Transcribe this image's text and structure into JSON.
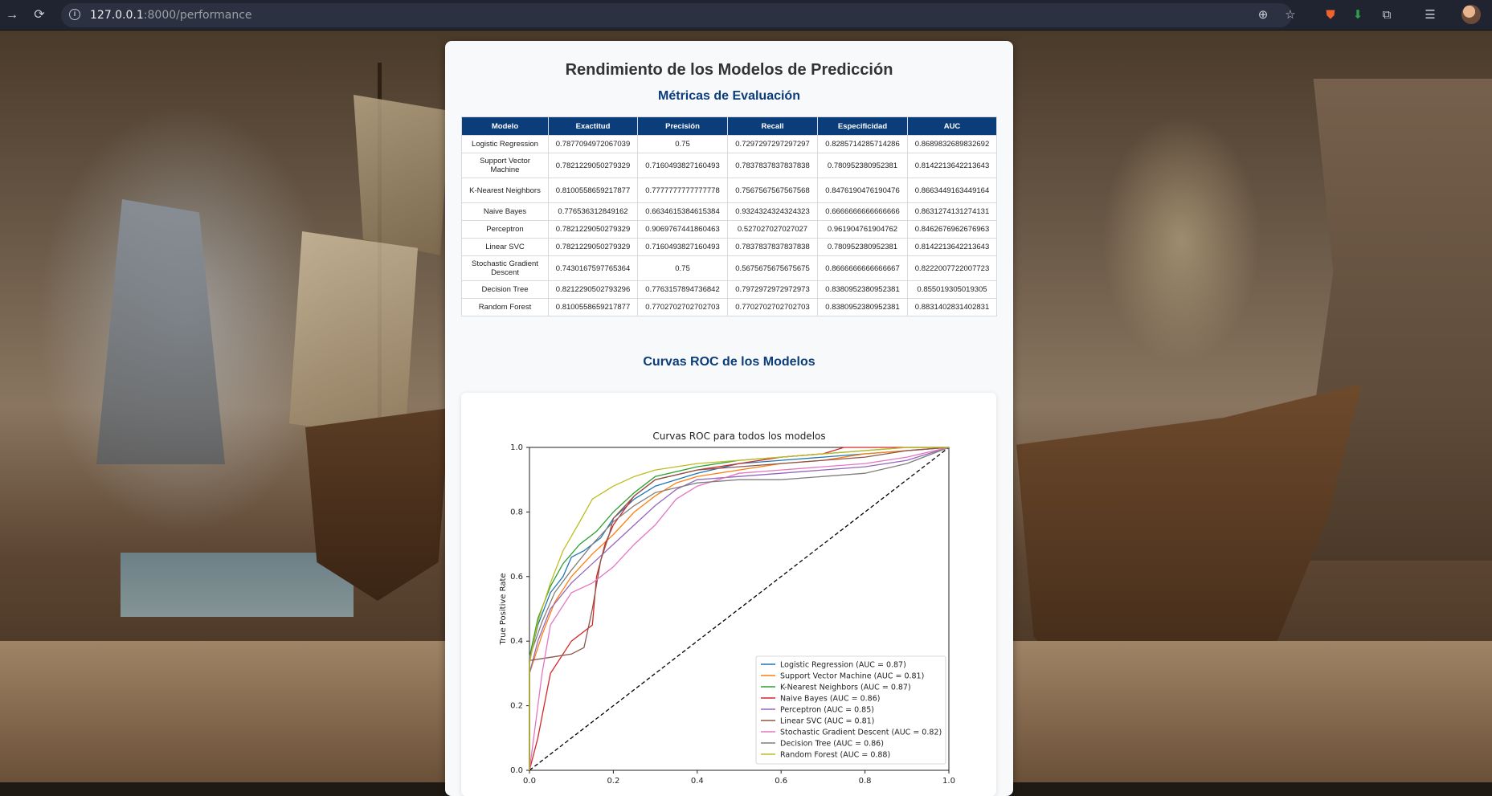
{
  "browser": {
    "url_host": "127.0.0.1",
    "url_path": ":8000/performance"
  },
  "page": {
    "title": "Rendimiento de los Modelos de Predicción",
    "metrics_heading": "Métricas de Evaluación",
    "roc_heading": "Curvas ROC de los Modelos"
  },
  "table": {
    "headers": [
      "Modelo",
      "Exactitud",
      "Precisión",
      "Recall",
      "Especificidad",
      "AUC"
    ],
    "rows": [
      [
        "Logistic Regression",
        "0.7877094972067039",
        "0.75",
        "0.7297297297297297",
        "0.8285714285714286",
        "0.8689832689832692"
      ],
      [
        "Support Vector Machine",
        "0.7821229050279329",
        "0.7160493827160493",
        "0.7837837837837838",
        "0.780952380952381",
        "0.8142213642213643"
      ],
      [
        "K-Nearest Neighbors",
        "0.8100558659217877",
        "0.7777777777777778",
        "0.7567567567567568",
        "0.8476190476190476",
        "0.8663449163449164"
      ],
      [
        "Naive Bayes",
        "0.776536312849162",
        "0.6634615384615384",
        "0.9324324324324323",
        "0.6666666666666666",
        "0.8631274131274131"
      ],
      [
        "Perceptron",
        "0.7821229050279329",
        "0.9069767441860463",
        "0.527027027027027",
        "0.961904761904762",
        "0.8462676962676963"
      ],
      [
        "Linear SVC",
        "0.7821229050279329",
        "0.7160493827160493",
        "0.7837837837837838",
        "0.780952380952381",
        "0.8142213642213643"
      ],
      [
        "Stochastic Gradient Descent",
        "0.7430167597765364",
        "0.75",
        "0.5675675675675675",
        "0.8666666666666667",
        "0.8222007722007723"
      ],
      [
        "Decision Tree",
        "0.8212290502793296",
        "0.7763157894736842",
        "0.7972972972972973",
        "0.8380952380952381",
        "0.855019305019305"
      ],
      [
        "Random Forest",
        "0.8100558659217877",
        "0.7702702702702703",
        "0.7702702702702703",
        "0.8380952380952381",
        "0.8831402831402831"
      ]
    ]
  },
  "chart_data": {
    "type": "line",
    "title": "Curvas ROC para todos los modelos",
    "xlabel": "",
    "ylabel": "True Positive Rate",
    "xlim": [
      0,
      1
    ],
    "ylim": [
      0,
      1
    ],
    "y_ticks": [
      "0.0",
      "0.2",
      "0.4",
      "0.6",
      "0.8",
      "1.0"
    ],
    "x_ticks": [
      "0.0",
      "0.2",
      "0.4",
      "0.6",
      "0.8",
      "1.0"
    ],
    "grid": false,
    "legend_position": "lower-right",
    "series": [
      {
        "name": "Logistic Regression (AUC = 0.87)",
        "color": "#1f77b4",
        "x": [
          0,
          0,
          0.02,
          0.05,
          0.08,
          0.1,
          0.13,
          0.17,
          0.2,
          0.25,
          0.3,
          0.35,
          0.4,
          0.5,
          0.6,
          0.7,
          0.8,
          0.9,
          1.0
        ],
        "y": [
          0,
          0.34,
          0.45,
          0.55,
          0.6,
          0.66,
          0.68,
          0.72,
          0.78,
          0.84,
          0.88,
          0.9,
          0.92,
          0.95,
          0.96,
          0.97,
          0.98,
          0.99,
          1.0
        ]
      },
      {
        "name": "Support Vector Machine (AUC = 0.81)",
        "color": "#ff7f0e",
        "x": [
          0,
          0,
          0.03,
          0.06,
          0.1,
          0.15,
          0.2,
          0.25,
          0.3,
          0.35,
          0.4,
          0.5,
          0.6,
          0.7,
          0.8,
          0.9,
          1.0
        ],
        "y": [
          0,
          0.3,
          0.42,
          0.52,
          0.6,
          0.67,
          0.73,
          0.8,
          0.85,
          0.89,
          0.91,
          0.93,
          0.95,
          0.96,
          0.98,
          0.99,
          1.0
        ]
      },
      {
        "name": "K-Nearest Neighbors (AUC = 0.87)",
        "color": "#2ca02c",
        "x": [
          0,
          0,
          0.02,
          0.05,
          0.08,
          0.12,
          0.16,
          0.2,
          0.25,
          0.3,
          0.4,
          0.5,
          0.6,
          0.7,
          0.8,
          0.9,
          1.0
        ],
        "y": [
          0,
          0.35,
          0.47,
          0.57,
          0.64,
          0.7,
          0.74,
          0.8,
          0.86,
          0.91,
          0.94,
          0.96,
          0.97,
          0.98,
          0.99,
          1.0,
          1.0
        ]
      },
      {
        "name": "Naive Bayes (AUC = 0.86)",
        "color": "#d62728",
        "x": [
          0,
          0.02,
          0.05,
          0.1,
          0.15,
          0.16,
          0.18,
          0.2,
          0.25,
          0.3,
          0.4,
          0.5,
          0.6,
          0.7,
          0.75,
          0.8,
          0.9,
          1.0
        ],
        "y": [
          0,
          0.1,
          0.3,
          0.4,
          0.45,
          0.6,
          0.7,
          0.76,
          0.85,
          0.9,
          0.93,
          0.95,
          0.97,
          0.98,
          1.0,
          1.0,
          1.0,
          1.0
        ]
      },
      {
        "name": "Perceptron (AUC = 0.85)",
        "color": "#9467bd",
        "x": [
          0,
          0,
          0.02,
          0.05,
          0.1,
          0.15,
          0.2,
          0.25,
          0.3,
          0.35,
          0.4,
          0.5,
          0.6,
          0.7,
          0.8,
          0.9,
          1.0
        ],
        "y": [
          0,
          0.3,
          0.4,
          0.5,
          0.58,
          0.64,
          0.7,
          0.76,
          0.82,
          0.87,
          0.9,
          0.91,
          0.92,
          0.93,
          0.94,
          0.96,
          1.0
        ]
      },
      {
        "name": "Linear SVC (AUC = 0.81)",
        "color": "#8c564b",
        "x": [
          0,
          0,
          0.05,
          0.1,
          0.13,
          0.15,
          0.17,
          0.19,
          0.2,
          0.25,
          0.3,
          0.4,
          0.5,
          0.6,
          0.7,
          0.8,
          0.9,
          1.0
        ],
        "y": [
          0,
          0.34,
          0.35,
          0.36,
          0.38,
          0.5,
          0.65,
          0.73,
          0.78,
          0.85,
          0.9,
          0.93,
          0.94,
          0.95,
          0.96,
          0.97,
          0.99,
          1.0
        ]
      },
      {
        "name": "Stochastic Gradient Descent (AUC = 0.82)",
        "color": "#e377c2",
        "x": [
          0,
          0.03,
          0.05,
          0.1,
          0.15,
          0.2,
          0.25,
          0.3,
          0.35,
          0.4,
          0.45,
          0.5,
          0.6,
          0.7,
          0.8,
          0.9,
          1.0
        ],
        "y": [
          0,
          0.3,
          0.45,
          0.55,
          0.58,
          0.63,
          0.7,
          0.76,
          0.84,
          0.88,
          0.9,
          0.92,
          0.93,
          0.94,
          0.95,
          0.97,
          1.0
        ]
      },
      {
        "name": "Decision Tree (AUC = 0.86)",
        "color": "#7f7f7f",
        "x": [
          0,
          0,
          0.03,
          0.06,
          0.1,
          0.15,
          0.2,
          0.25,
          0.3,
          0.4,
          0.5,
          0.6,
          0.7,
          0.8,
          0.9,
          1.0
        ],
        "y": [
          0,
          0.35,
          0.46,
          0.55,
          0.62,
          0.7,
          0.77,
          0.82,
          0.86,
          0.89,
          0.9,
          0.9,
          0.91,
          0.92,
          0.95,
          1.0
        ]
      },
      {
        "name": "Random Forest (AUC = 0.88)",
        "color": "#bcbd22",
        "x": [
          0,
          0,
          0.02,
          0.05,
          0.08,
          0.12,
          0.15,
          0.2,
          0.25,
          0.3,
          0.4,
          0.5,
          0.6,
          0.7,
          0.8,
          0.9,
          1.0
        ],
        "y": [
          0,
          0.33,
          0.46,
          0.58,
          0.68,
          0.77,
          0.84,
          0.88,
          0.91,
          0.93,
          0.95,
          0.96,
          0.97,
          0.98,
          0.99,
          1.0,
          1.0
        ]
      }
    ]
  }
}
